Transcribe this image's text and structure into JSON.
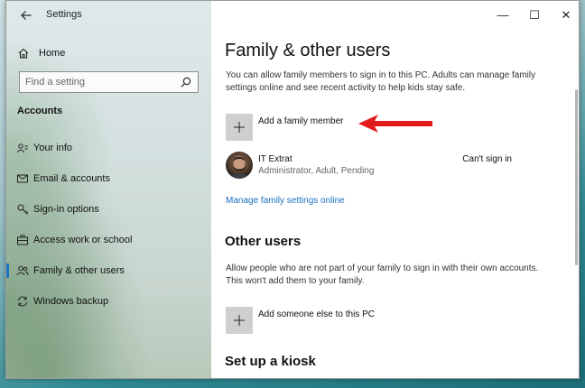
{
  "window": {
    "title": "Settings",
    "back_icon": "back-arrow-icon",
    "minimize_glyph": "—",
    "maximize_glyph": "☐",
    "close_glyph": "✕"
  },
  "sidebar": {
    "home_label": "Home",
    "search_placeholder": "Find a setting",
    "section_title": "Accounts",
    "items": [
      {
        "label": "Your info",
        "icon": "person-card-icon"
      },
      {
        "label": "Email & accounts",
        "icon": "envelope-icon"
      },
      {
        "label": "Sign-in options",
        "icon": "key-icon"
      },
      {
        "label": "Access work or school",
        "icon": "briefcase-icon"
      },
      {
        "label": "Family & other users",
        "icon": "people-icon",
        "active": true
      },
      {
        "label": "Windows backup",
        "icon": "sync-icon"
      }
    ]
  },
  "main": {
    "title": "Family & other users",
    "description": "You can allow family members to sign in to this PC. Adults can manage family settings online and see recent activity to help kids stay safe.",
    "add_family_label": "Add a family member",
    "family_member": {
      "name": "IT Extrat",
      "detail": "Administrator, Adult, Pending",
      "status": "Can't sign in"
    },
    "manage_link": "Manage family settings online",
    "other_users_title": "Other users",
    "other_users_description": "Allow people who are not part of your family to sign in with their own accounts. This won't add them to your family.",
    "add_other_label": "Add someone else to this PC",
    "kiosk_title": "Set up a kiosk"
  },
  "colors": {
    "accent": "#1a73c4",
    "link": "#1a6fbf",
    "annotation_arrow": "#e31b1b",
    "tile": "#cfcfcf"
  }
}
